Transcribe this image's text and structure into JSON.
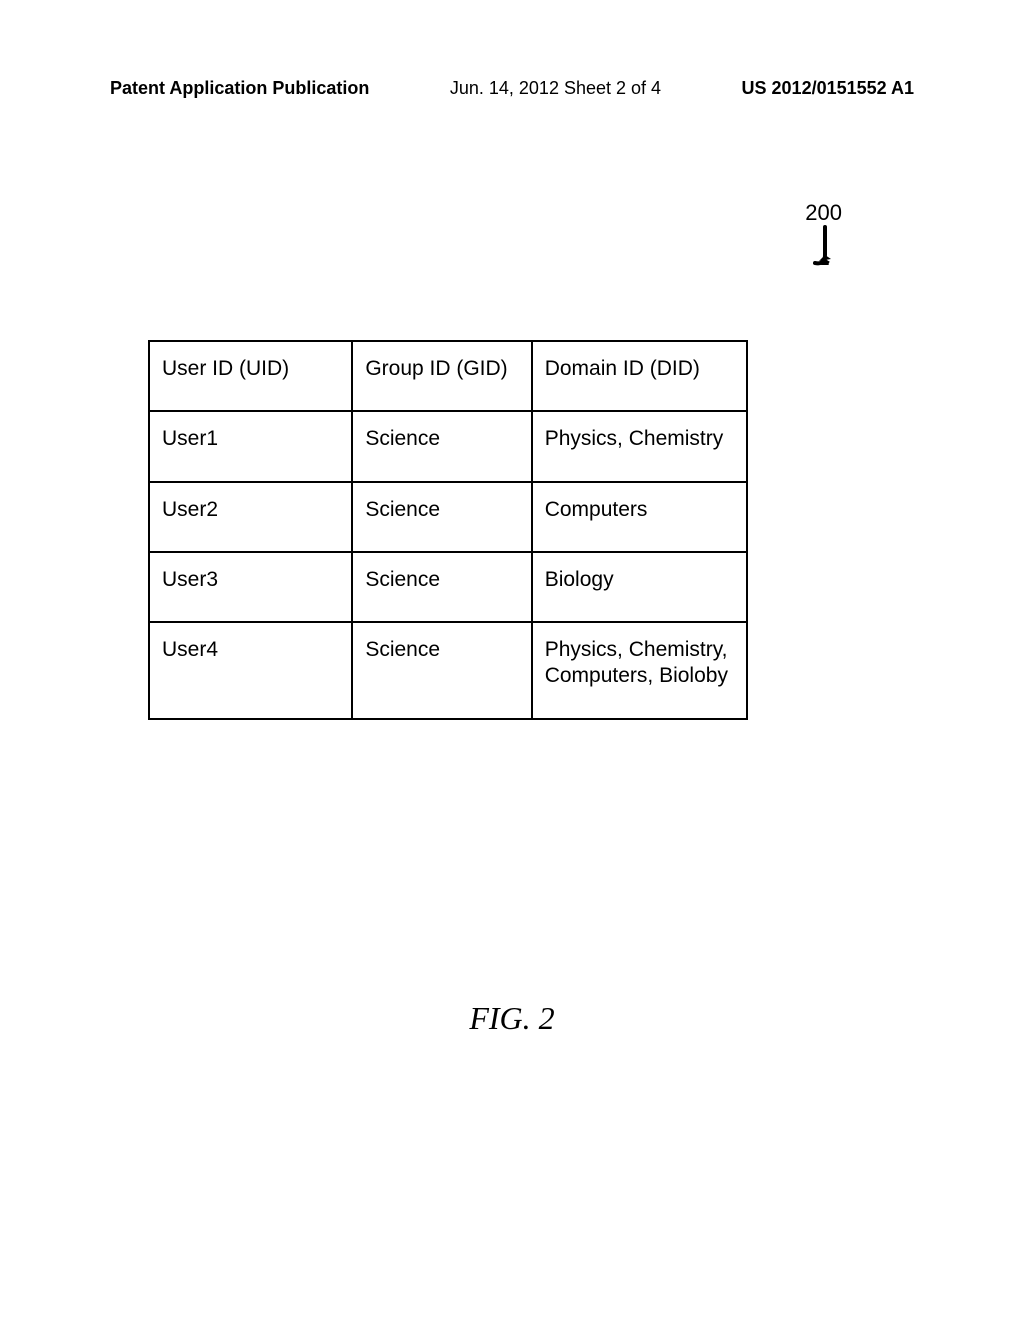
{
  "header": {
    "left": "Patent Application Publication",
    "center": "Jun. 14, 2012  Sheet 2 of 4",
    "right": "US 2012/0151552 A1"
  },
  "reference_number": "200",
  "table": {
    "headers": {
      "uid": "User ID (UID)",
      "gid": "Group ID (GID)",
      "did": "Domain ID (DID)"
    },
    "rows": [
      {
        "uid": "User1",
        "gid": "Science",
        "did": "Physics, Chemistry"
      },
      {
        "uid": "User2",
        "gid": "Science",
        "did": "Computers"
      },
      {
        "uid": "User3",
        "gid": "Science",
        "did": "Biology"
      },
      {
        "uid": "User4",
        "gid": "Science",
        "did": "Physics, Chemistry, Computers, Bioloby"
      }
    ]
  },
  "figure_caption": "FIG. 2"
}
